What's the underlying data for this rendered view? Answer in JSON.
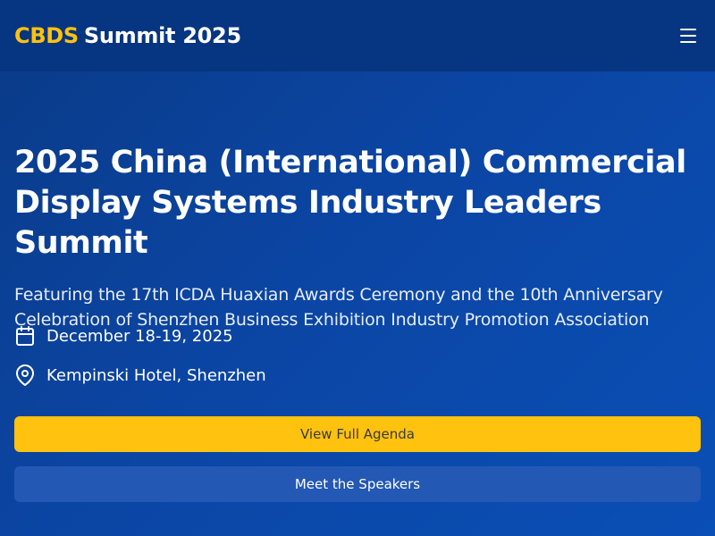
{
  "header": {
    "brand_accent": "CBDS",
    "brand_rest": "Summit 2025",
    "menu_icon": "hamburger-menu-icon"
  },
  "hero": {
    "title": "2025 China (International) Commercial Display Systems Industry Leaders Summit",
    "subtitle": "Featuring the 17th ICDA Huaxian Awards Ceremony and the 10th Anniversary Celebration of Shenzhen Business Exhibition Industry Promotion Association"
  },
  "details": {
    "date_icon": "calendar-icon",
    "date": "December 18-19, 2025",
    "location_icon": "map-pin-icon",
    "location": "Kempinski Hotel, Shenzhen"
  },
  "actions": {
    "primary_label": "View Full Agenda",
    "secondary_label": "Meet the Speakers"
  },
  "colors": {
    "accent": "#ffc20e",
    "header_bg": "#063581",
    "hero_bg": "#0b45a3",
    "secondary_button": "#2358b4"
  }
}
